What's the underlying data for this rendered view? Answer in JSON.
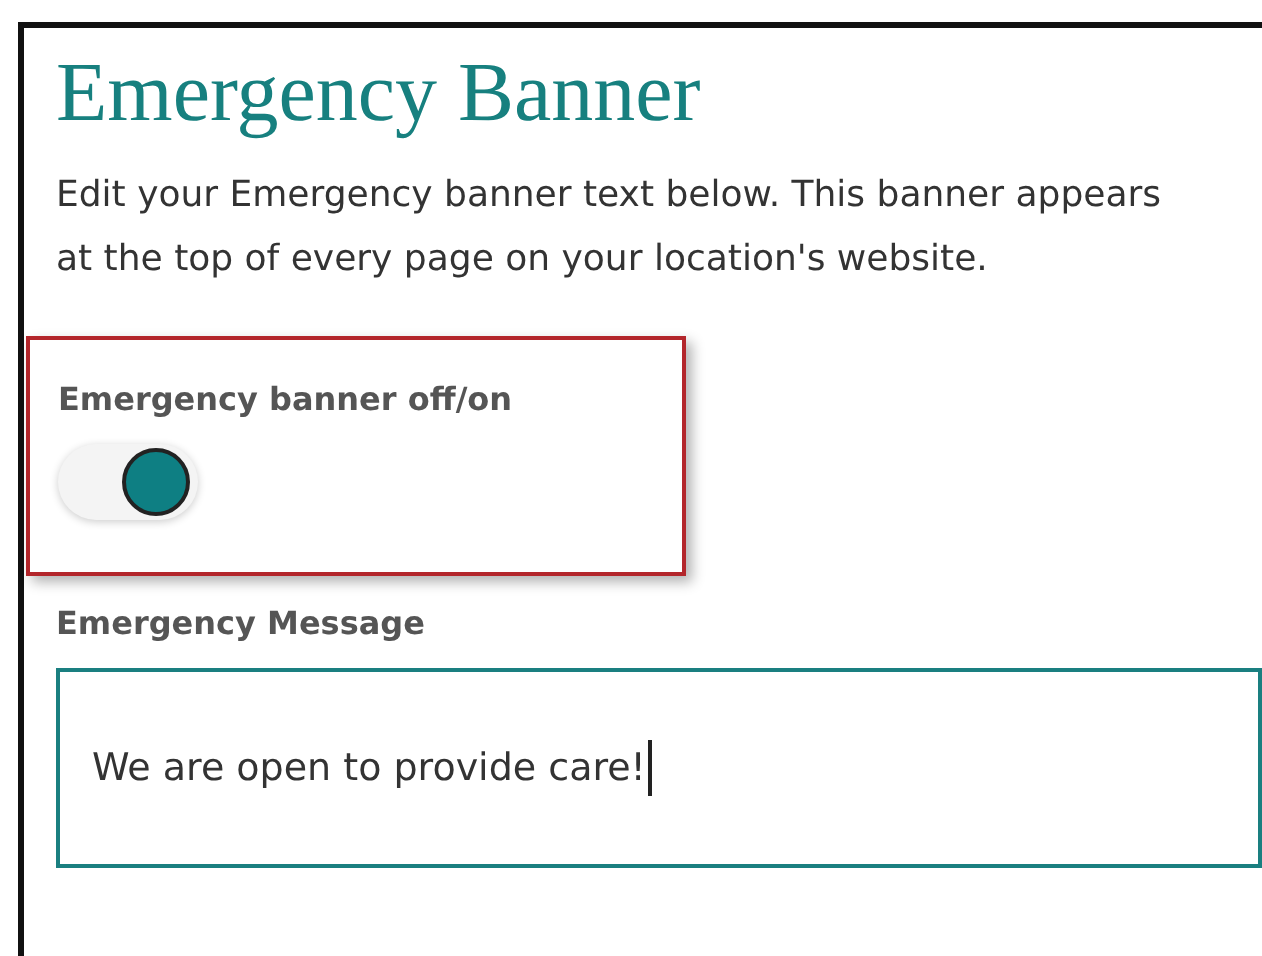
{
  "title": "Emergency Banner",
  "description": "Edit your Emergency banner text below. This banner appears at the top of every page on your location's website.",
  "toggle": {
    "label": "Emergency banner off/on",
    "on": true
  },
  "message": {
    "label": "Emergency Message",
    "value": "We are open to provide care!"
  }
}
